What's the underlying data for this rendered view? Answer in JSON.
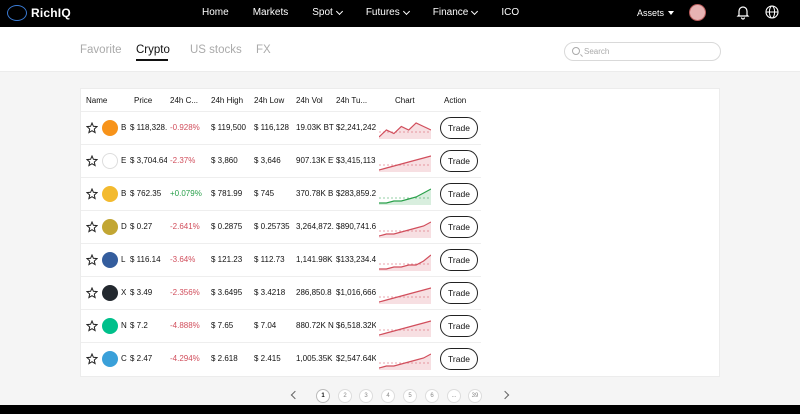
{
  "brand": {
    "name": "RichIQ"
  },
  "nav": [
    {
      "label": "Home",
      "dropdown": false
    },
    {
      "label": "Markets",
      "dropdown": false
    },
    {
      "label": "Spot",
      "dropdown": true
    },
    {
      "label": "Futures",
      "dropdown": true
    },
    {
      "label": "Finance",
      "dropdown": true
    },
    {
      "label": "ICO",
      "dropdown": false
    }
  ],
  "header": {
    "assets_label": "Assets"
  },
  "tabs": [
    {
      "label": "Favorite",
      "active": false
    },
    {
      "label": "Crypto",
      "active": true
    },
    {
      "label": "US stocks",
      "active": false
    },
    {
      "label": "FX",
      "active": false
    }
  ],
  "search": {
    "placeholder": "Search",
    "value": ""
  },
  "table": {
    "columns": [
      "Name",
      "Price",
      "24h C...",
      "24h High",
      "24h Low",
      "24h Vol",
      "24h Tu...",
      "Chart",
      "Action"
    ],
    "trade_label": "Trade",
    "rows": [
      {
        "coin_letter": "B",
        "coin_color": "#f7931a",
        "coin_icon": "bitcoin-icon",
        "price": "$ 118,328.",
        "change": "-0.928%",
        "change_dir": "neg",
        "high": "$ 119,500",
        "low": "$ 116,128",
        "vol": "19.03K BT",
        "turnover": "$2,241,242",
        "trend": "neg",
        "spark": [
          5,
          7,
          6,
          8,
          7,
          9,
          8,
          7
        ]
      },
      {
        "coin_letter": "E",
        "coin_color": "#ffffff",
        "coin_icon": "ethereum-icon",
        "price": "$ 3,704.64",
        "change": "-2.37%",
        "change_dir": "neg",
        "high": "$ 3,860",
        "low": "$ 3,646",
        "vol": "907.13K ET",
        "turnover": "$3,415,113",
        "trend": "neg",
        "spark": [
          2,
          3,
          4,
          5,
          6,
          7,
          8,
          9
        ]
      },
      {
        "coin_letter": "B",
        "coin_color": "#f3ba2f",
        "coin_icon": "bnb-icon",
        "price": "$ 762.35",
        "change": "+0.079%",
        "change_dir": "pos",
        "high": "$ 781.99",
        "low": "$ 745",
        "vol": "370.78K BI",
        "turnover": "$283,859.2",
        "trend": "pos",
        "spark": [
          2,
          2,
          3,
          3,
          4,
          5,
          7,
          9
        ]
      },
      {
        "coin_letter": "D",
        "coin_color": "#c2a633",
        "coin_icon": "dogecoin-icon",
        "price": "$ 0.27",
        "change": "-2.641%",
        "change_dir": "neg",
        "high": "$ 0.2875",
        "low": "$ 0.25735",
        "vol": "3,264,872.",
        "turnover": "$890,741.6",
        "trend": "neg",
        "spark": [
          2,
          3,
          3,
          4,
          5,
          6,
          7,
          9
        ]
      },
      {
        "coin_letter": "L",
        "coin_color": "#345d9d",
        "coin_icon": "litecoin-icon",
        "price": "$ 116.14",
        "change": "-3.64%",
        "change_dir": "neg",
        "high": "$ 121.23",
        "low": "$ 112.73",
        "vol": "1,141.98K",
        "turnover": "$133,234.4",
        "trend": "neg",
        "spark": [
          2,
          2,
          3,
          3,
          4,
          4,
          6,
          9
        ]
      },
      {
        "coin_letter": "X",
        "coin_color": "#23292f",
        "coin_icon": "xrp-icon",
        "price": "$ 3.49",
        "change": "-2.356%",
        "change_dir": "neg",
        "high": "$ 3.6495",
        "low": "$ 3.4218",
        "vol": "286,850.8",
        "turnover": "$1,016,666",
        "trend": "neg",
        "spark": [
          2,
          3,
          4,
          5,
          6,
          7,
          8,
          9
        ]
      },
      {
        "coin_letter": "N",
        "coin_color": "#00c08b",
        "coin_icon": "near-icon",
        "price": "$ 7.2",
        "change": "-4.888%",
        "change_dir": "neg",
        "high": "$ 7.65",
        "low": "$ 7.04",
        "vol": "880.72K N",
        "turnover": "$6,518.32K",
        "trend": "neg",
        "spark": [
          2,
          3,
          4,
          5,
          6,
          7,
          8,
          9
        ]
      },
      {
        "coin_letter": "C",
        "coin_color": "#3aa0d9",
        "coin_icon": "cardano-icon",
        "price": "$ 2.47",
        "change": "-4.294%",
        "change_dir": "neg",
        "high": "$ 2.618",
        "low": "$ 2.415",
        "vol": "1,005.35K",
        "turnover": "$2,547.64K",
        "trend": "neg",
        "spark": [
          2,
          3,
          3,
          4,
          5,
          6,
          7,
          9
        ]
      }
    ]
  },
  "pagination": {
    "current": "1",
    "pages": [
      "1",
      "2",
      "3",
      "4",
      "5",
      "6",
      "...",
      "39"
    ]
  },
  "colors": {
    "negative": "#d14e5c",
    "positive": "#29a04a",
    "topbar": "#000000"
  }
}
